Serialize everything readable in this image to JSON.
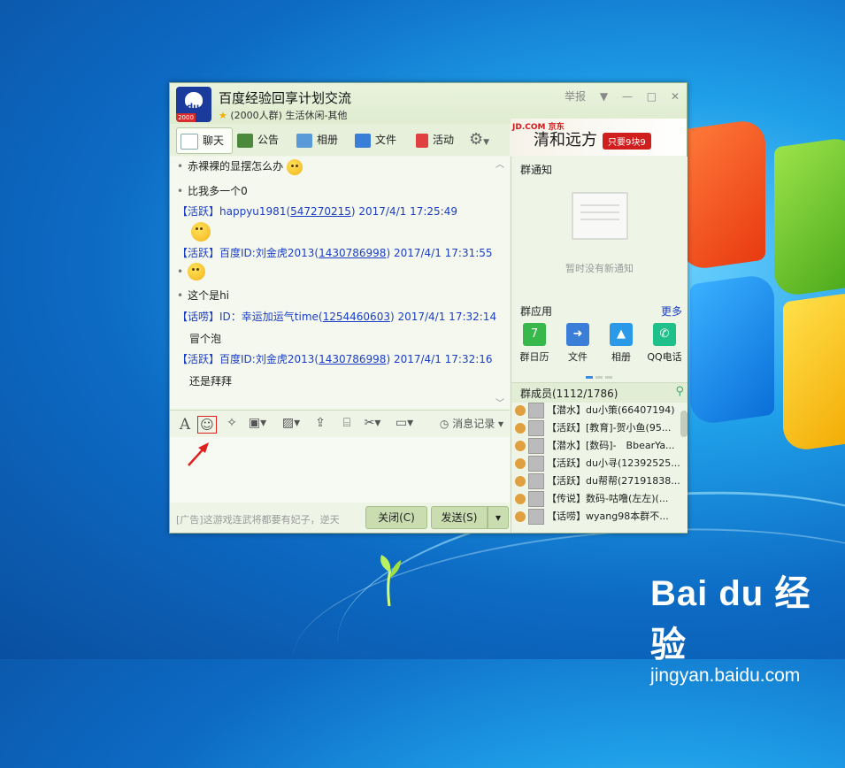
{
  "window": {
    "group_name": "百度经验回享计划交流",
    "group_meta": "(2000人群) 生活休闲-其他",
    "report": "举报",
    "tabs": [
      "聊天",
      "公告",
      "相册",
      "文件",
      "活动"
    ]
  },
  "ad_banner": {
    "brand": "JD.COM 京东",
    "text": "清和远方",
    "tag": "只要9块9"
  },
  "chat": {
    "messages": [
      {
        "type": "text",
        "text": "赤裸裸的显摆怎么办"
      },
      {
        "type": "text",
        "text": "比我多一个0"
      },
      {
        "type": "header",
        "badge": "【活跃】",
        "name": "happyu1981",
        "qq": "547270215",
        "time": "2017/4/1 17:25:49"
      },
      {
        "type": "header",
        "badge": "【活跃】",
        "name": "百度ID:刘金虎2013",
        "qq": "1430786998",
        "time": "2017/4/1 17:31:55"
      },
      {
        "type": "text",
        "text": "这个是hi"
      },
      {
        "type": "header",
        "badge": "【话唠】",
        "name": "ID：幸运加运气time",
        "qq": "1254460603",
        "time": "2017/4/1 17:32:14"
      },
      {
        "type": "plain",
        "text": "冒个泡"
      },
      {
        "type": "header",
        "badge": "【活跃】",
        "name": "百度ID:刘金虎2013",
        "qq": "1430786998",
        "time": "2017/4/1 17:32:16"
      },
      {
        "type": "plain",
        "text": "还是拜拜"
      }
    ]
  },
  "toolbar": {
    "history": "消息记录"
  },
  "bottom": {
    "ad": "[广告]这游戏连武将都要有妃子，逆天",
    "close": "关闭(C)",
    "send": "发送(S)"
  },
  "right": {
    "notice_title": "群通知",
    "no_notice": "暂时没有新通知",
    "apps_title": "群应用",
    "more": "更多",
    "apps": [
      "群日历",
      "文件",
      "相册",
      "QQ电话"
    ],
    "members_title": "群成员(1112/1786)",
    "members": [
      "【潜水】du小策(66407194)",
      "【活跃】[教育]-贺小鱼(95...",
      "【潜水】[数码]-　BbearYa...",
      "【活跃】du小寻(12392525...",
      "【活跃】du帮帮(27191838...",
      "【传说】数码-咕噜(左左)(...",
      "【话唠】wyang98本群不..."
    ]
  },
  "watermark": {
    "logo": "Bai du 经验",
    "url": "jingyan.baidu.com"
  }
}
